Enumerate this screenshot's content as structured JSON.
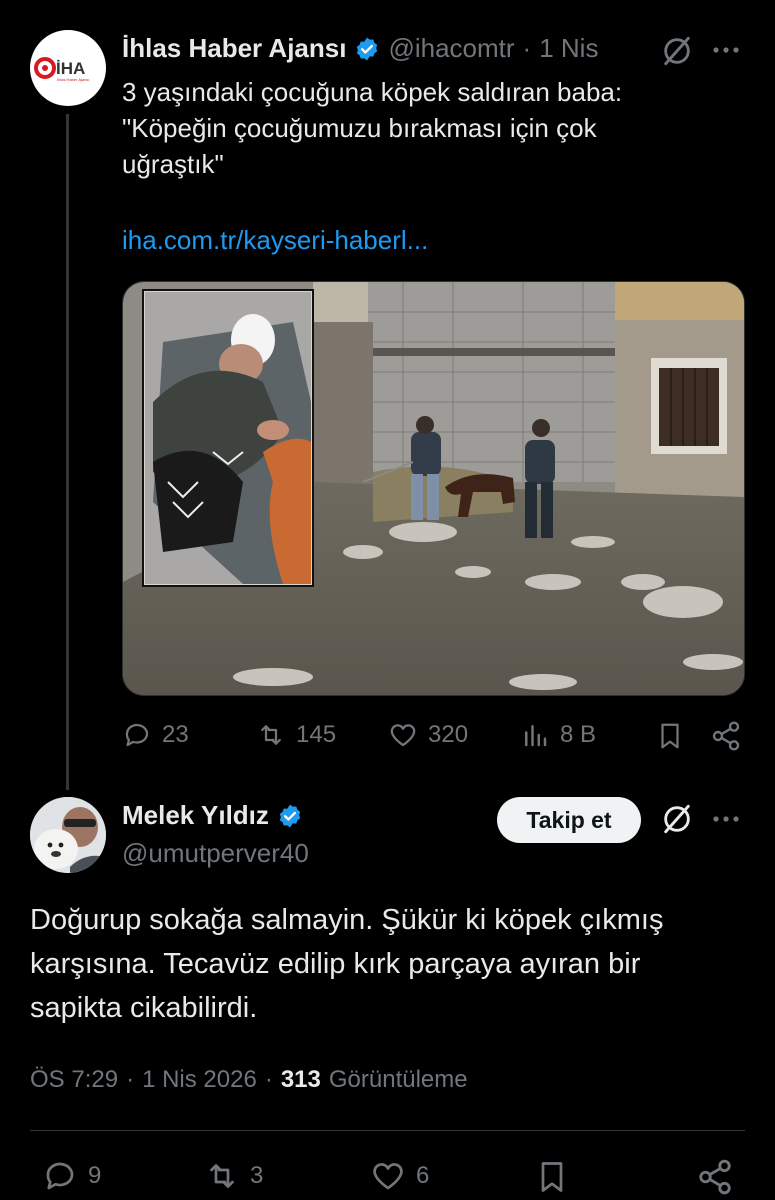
{
  "colors": {
    "background": "#000000",
    "text": "#e7e9ea",
    "muted": "#71767b",
    "link": "#1d9bf0",
    "verified": "#1d9bf0"
  },
  "original_tweet": {
    "avatar_logo_text": "İHA",
    "avatar_logo_subtext": "İhlas Haber Ajansı",
    "author_name": "İhlas Haber Ajansı",
    "handle": "@ihacomtr",
    "dot": "·",
    "time": "1 Nis",
    "text_line1": "3 yaşındaki çocuğuna köpek saldıran baba:",
    "text_line2": "\"Köpeğin çocuğumuzu bırakması için çok",
    "text_line3": "uğraştık\"",
    "link": "iha.com.tr/kayseri-haberl...",
    "stats": {
      "replies": "23",
      "reposts": "145",
      "likes": "320",
      "views": "8 B"
    },
    "icons": [
      "verified-badge-icon",
      "grok-icon",
      "more-icon",
      "reply-icon",
      "repost-icon",
      "like-icon",
      "views-icon",
      "bookmark-icon",
      "share-icon"
    ]
  },
  "reply_tweet": {
    "author_name": "Melek Yıldız",
    "handle": "@umutperver40",
    "follow_label": "Takip et",
    "text_line1": "Doğurup sokağa salmayin. Şükür ki köpek çıkmış",
    "text_line2": "karşısına. Tecavüz edilip kırk parçaya ayıran bir",
    "text_line3": "sapikta cikabilirdi.",
    "meta_time": "ÖS 7:29",
    "meta_dot1": "·",
    "meta_date": "1 Nis 2026",
    "meta_dot2": "·",
    "views_count": "313",
    "views_label": "Görüntüleme",
    "stats": {
      "replies": "9",
      "reposts": "3",
      "likes": "6"
    }
  }
}
